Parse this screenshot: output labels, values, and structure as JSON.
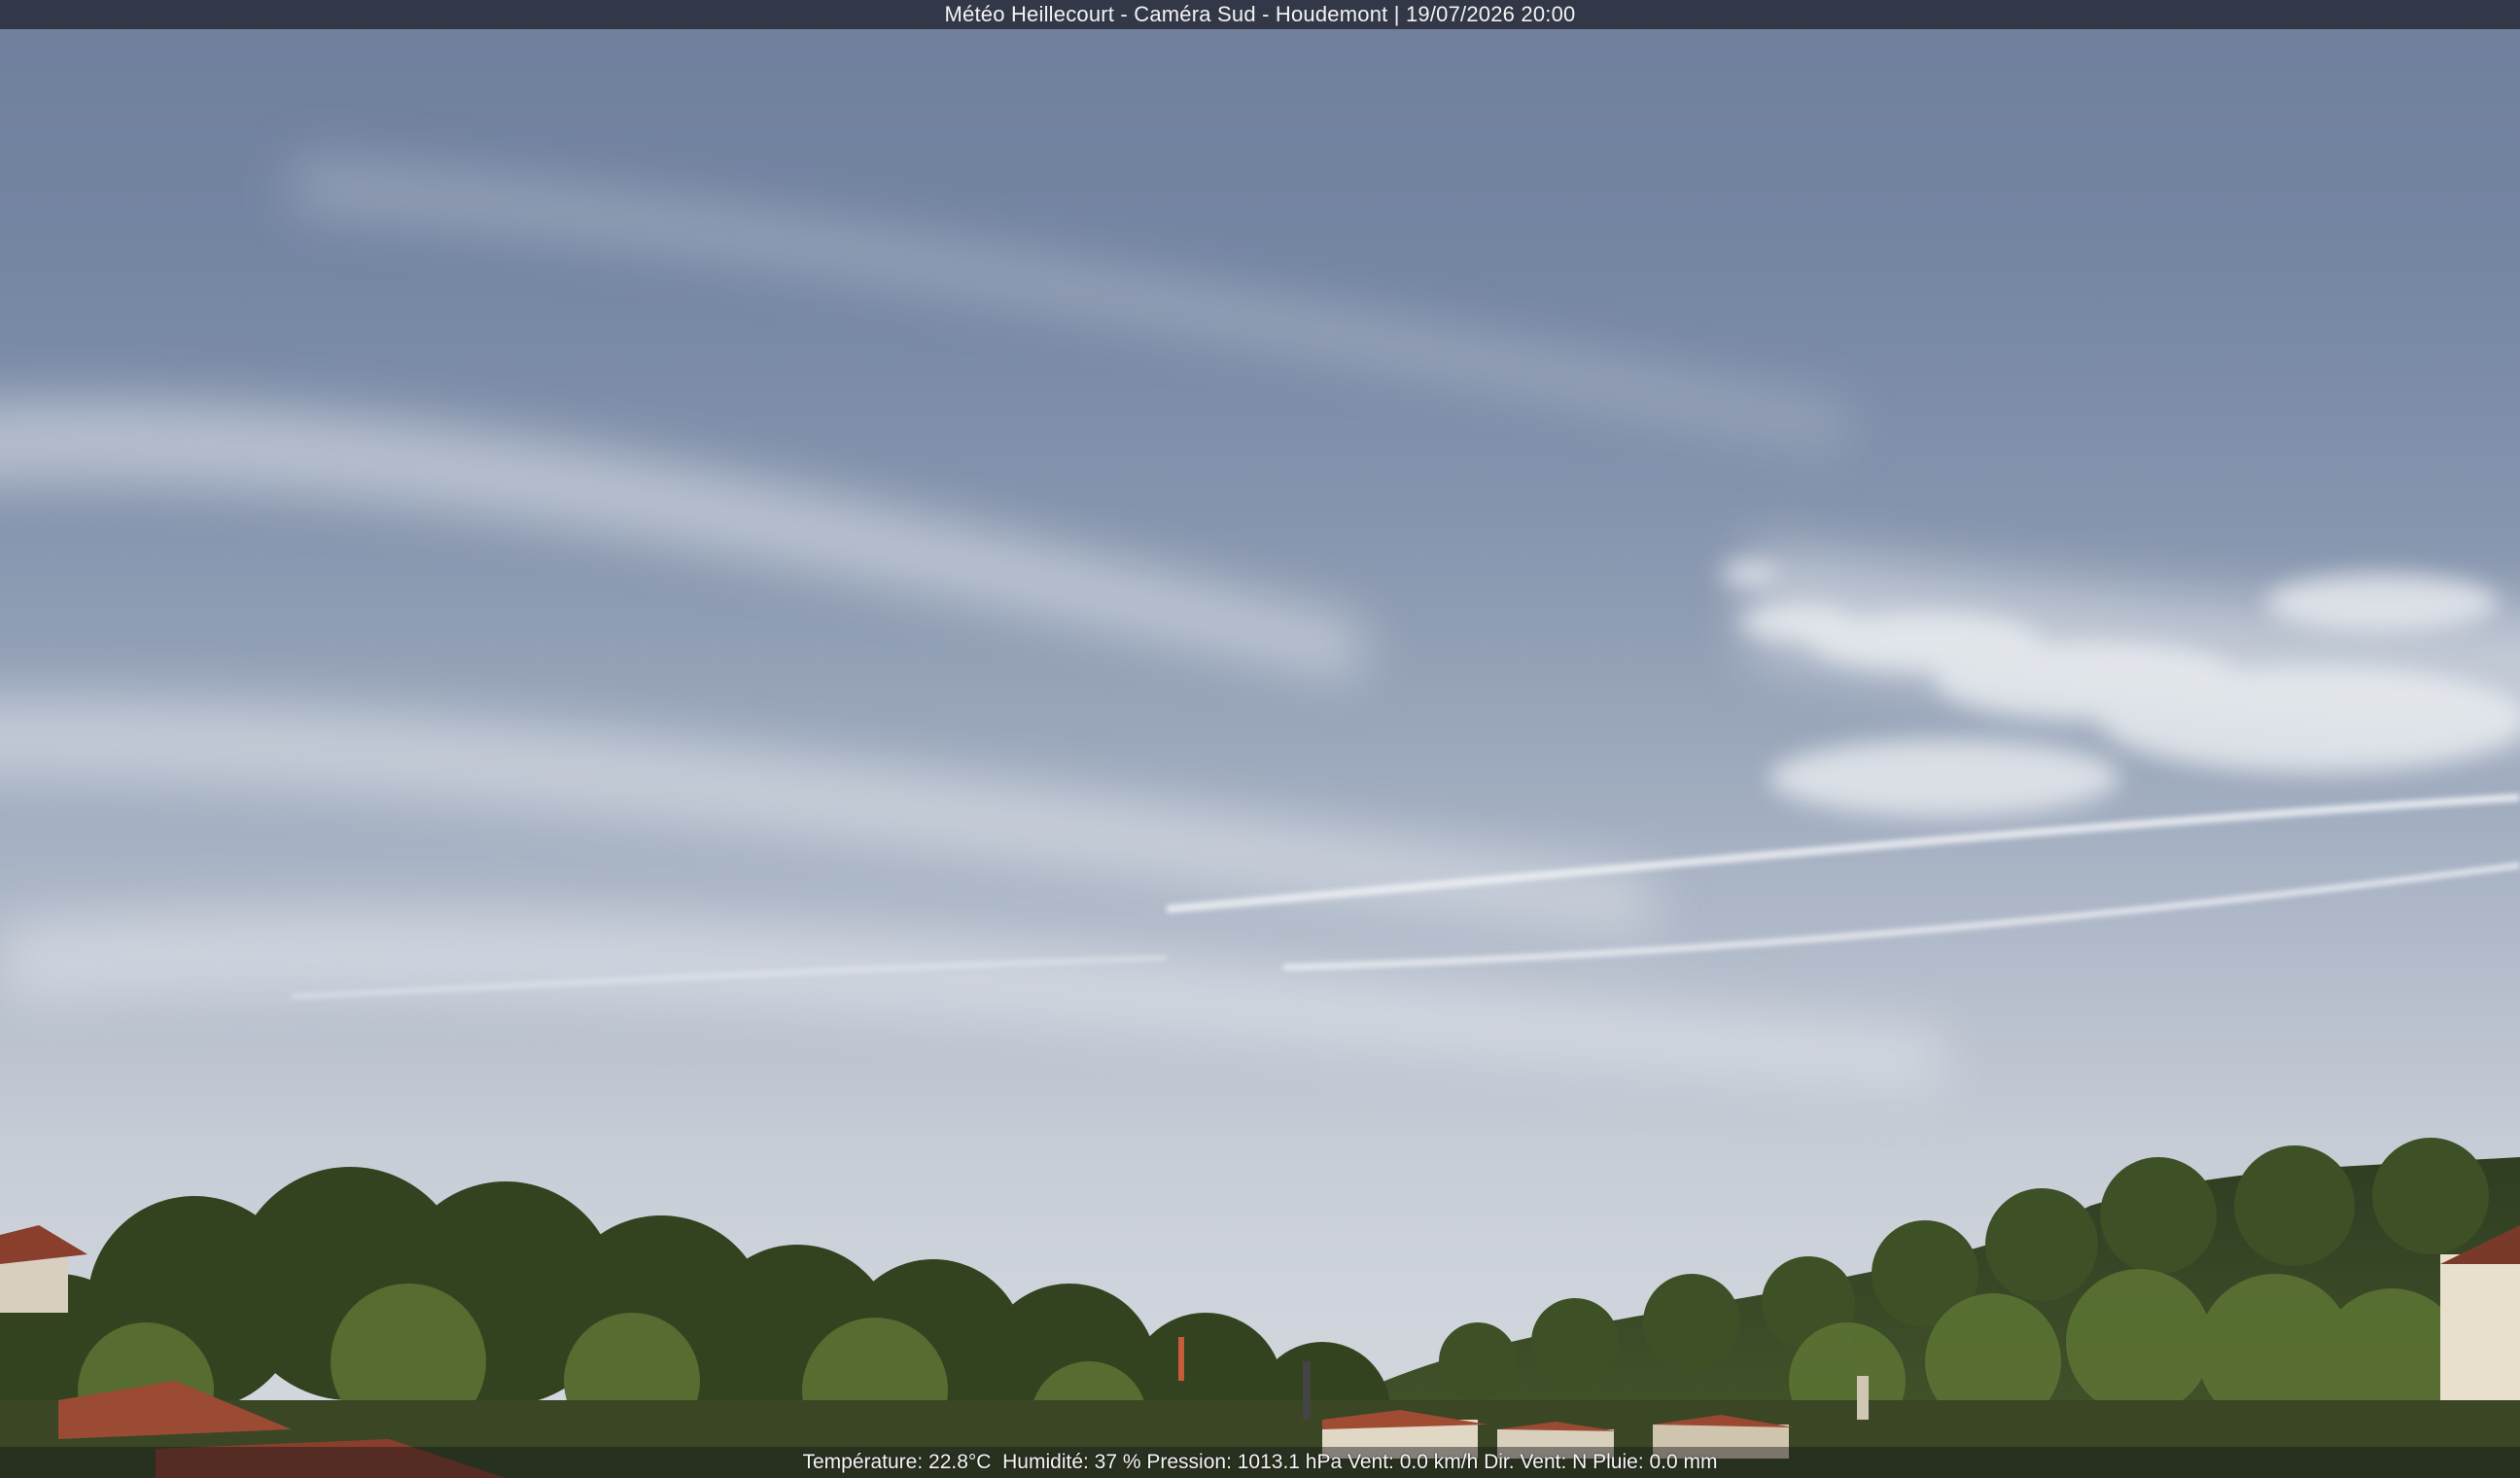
{
  "overlay": {
    "title": "Météo Heillecourt - Caméra Sud - Houdemont | 19/07/2026 20:00",
    "info": "Température: 22.8°C  Humidité: 37 % Pression: 1013.1 hPa Vent: 0.0 km/h Dir. Vent: N Pluie: 0.0 mm"
  },
  "colors": {
    "sky_top": "#6f7f9c",
    "sky_horizon": "#d4d8de",
    "trees_dark": "#2c3a1e",
    "trees_light": "#5d7234",
    "roof": "#9b4a33"
  }
}
